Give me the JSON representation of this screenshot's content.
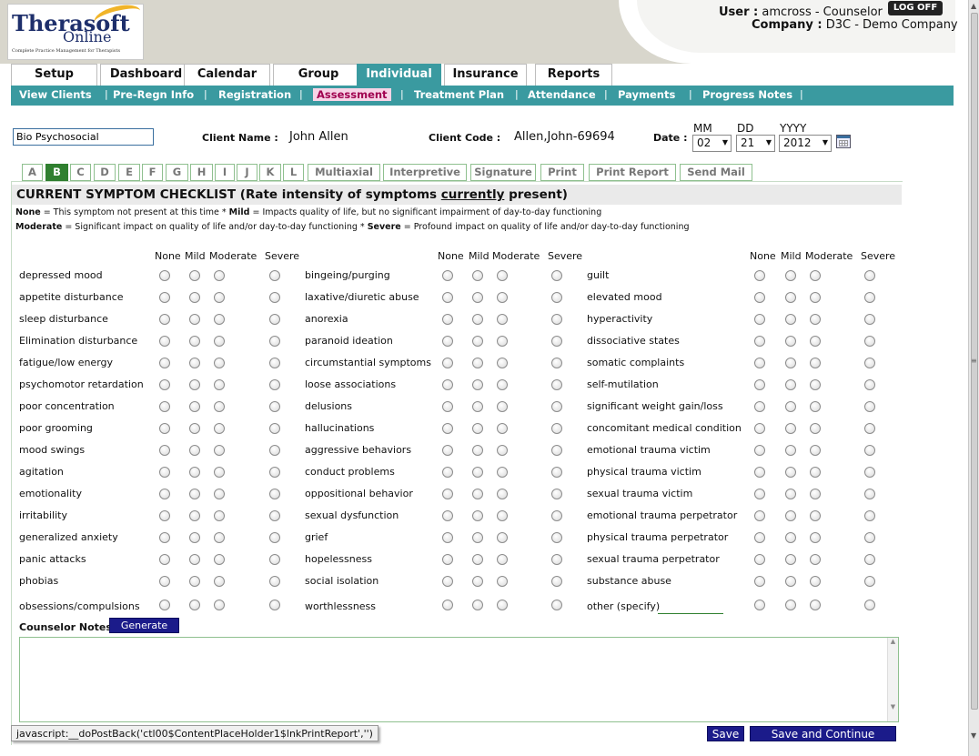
{
  "header": {
    "logo_main": "Therasoft",
    "logo_sub": "Online",
    "logo_tagline": "Complete Practice Management for Therapists",
    "user_label": "User :",
    "user_value": "amcross - Counselor",
    "company_label": "Company :",
    "company_value": "D3C - Demo Company",
    "logoff_label": "LOG OFF"
  },
  "tabs": [
    "Setup",
    "Dashboard",
    "Calendar",
    "Group",
    "Individual",
    "Insurance",
    "Reports"
  ],
  "active_tab": "Individual",
  "subnav": [
    "View Clients",
    "Pre-Regn Info",
    "Registration",
    "Assessment",
    "Treatment Plan",
    "Attendance",
    "Payments",
    "Progress Notes"
  ],
  "active_subnav": "Assessment",
  "form": {
    "name_value": "Bio Psychosocial",
    "client_name_label": "Client Name :",
    "client_name_value": "John Allen",
    "client_code_label": "Client Code :",
    "client_code_value": "Allen,John-69694",
    "date_label": "Date :",
    "mm_label": "MM",
    "dd_label": "DD",
    "yyyy_label": "YYYY",
    "mm_value": "02",
    "dd_value": "21",
    "yyyy_value": "2012"
  },
  "section_tabs": [
    "A",
    "B",
    "C",
    "D",
    "E",
    "F",
    "G",
    "H",
    "I",
    "J",
    "K",
    "L",
    "Multiaxial",
    "Interpretive",
    "Signature",
    "Print",
    "Print Report",
    "Send Mail"
  ],
  "active_section_tab": "B",
  "checklist": {
    "title_prefix": "CURRENT SYMPTOM CHECKLIST (Rate intensity of symptoms ",
    "title_underlined": "currently",
    "title_suffix": " present)",
    "legend_line1_none": "None",
    "legend_line1_text1": " = This symptom not present at this time * ",
    "legend_line1_mild": "Mild",
    "legend_line1_text2": " = Impacts quality of life, but no significant impairment of day-to-day functioning",
    "legend_line2_moderate": "Moderate",
    "legend_line2_text1": " = Significant impact on quality of life and/or day-to-day functioning * ",
    "legend_line2_severe": "Severe",
    "legend_line2_text2": " = Profound impact on quality of life and/or day-to-day functioning",
    "ratings": [
      "None",
      "Mild",
      "Moderate",
      "Severe"
    ],
    "columns": [
      [
        "depressed mood",
        "appetite disturbance",
        "sleep disturbance",
        "Elimination disturbance",
        "fatigue/low energy",
        "psychomotor retardation",
        "poor concentration",
        "poor grooming",
        "mood swings",
        "agitation",
        "emotionality",
        "irritability",
        "generalized anxiety",
        "panic attacks",
        "phobias",
        "obsessions/compulsions"
      ],
      [
        "bingeing/purging",
        "laxative/diuretic abuse",
        "anorexia",
        "paranoid ideation",
        "circumstantial symptoms",
        "loose associations",
        "delusions",
        "hallucinations",
        "aggressive behaviors",
        "conduct problems",
        "oppositional behavior",
        "sexual dysfunction",
        "grief",
        "hopelessness",
        "social isolation",
        "worthlessness"
      ],
      [
        "guilt",
        "elevated mood",
        "hyperactivity",
        "dissociative states",
        "somatic complaints",
        "self-mutilation",
        "significant weight gain/loss",
        "concomitant medical condition",
        "emotional trauma victim",
        "physical trauma victim",
        "sexual trauma victim",
        "emotional trauma perpetrator",
        "physical trauma perpetrator",
        "sexual trauma perpetrator",
        "substance abuse",
        "other (specify)"
      ]
    ]
  },
  "notes": {
    "label": "Counselor Notes:",
    "generate_label": "Generate",
    "value": ""
  },
  "footer": {
    "status_text": "javascript:__doPostBack('ctl00$ContentPlaceHolder1$lnkPrintReport','')",
    "save_label": "Save",
    "save_continue_label": "Save and Continue"
  },
  "colors": {
    "teal_nav": "#3a9aa0",
    "active_section": "#2f7f2f",
    "button_navy": "#1b1b8a",
    "assessment_highlight": "#f7d4e6"
  }
}
